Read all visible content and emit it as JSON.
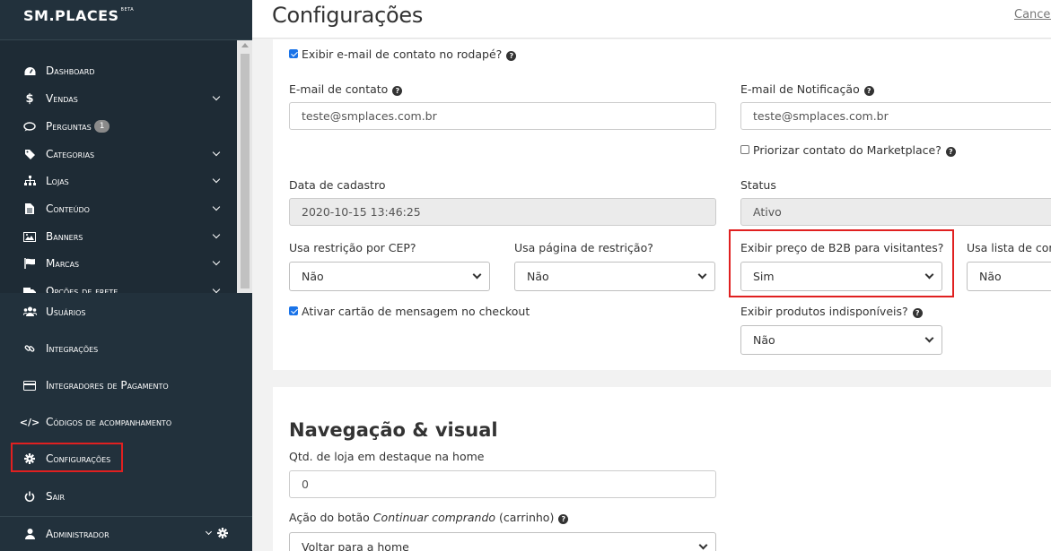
{
  "brand": {
    "logo": "SM.PLACES",
    "beta": "BETA"
  },
  "sidebar": {
    "items": [
      {
        "label": "Dashboard",
        "icon": "dashboard-icon"
      },
      {
        "label": "Vendas",
        "icon": "dollar-icon"
      },
      {
        "label": "Perguntas",
        "icon": "chat-icon",
        "badge": "1"
      },
      {
        "label": "Categorias",
        "icon": "tags-icon"
      },
      {
        "label": "Lojas",
        "icon": "sitemap-icon"
      },
      {
        "label": "Conteúdo",
        "icon": "file-icon"
      },
      {
        "label": "Banners",
        "icon": "image-icon"
      },
      {
        "label": "Marcas",
        "icon": "flag-icon"
      },
      {
        "label": "Opções de frete",
        "icon": "truck-icon"
      }
    ],
    "lower": [
      {
        "label": "Usuários",
        "icon": "users-icon"
      },
      {
        "label": "Integrações",
        "icon": "link-icon"
      },
      {
        "label": "Integradores de Pagamento",
        "icon": "credit-card-icon"
      },
      {
        "label": "Códigos de acompanhamento",
        "icon": "code-icon"
      },
      {
        "label": "Configurações",
        "icon": "gear-icon",
        "active": true
      },
      {
        "label": "Sair",
        "icon": "power-icon"
      }
    ],
    "user": {
      "label": "Administrador",
      "icon": "user-icon"
    }
  },
  "header": {
    "title": "Configurações",
    "cancel": "Cancela"
  },
  "form": {
    "show_email_footer": {
      "label": "Exibir e-mail de contato no rodapé?",
      "checked": true
    },
    "contact_email": {
      "label": "E-mail de contato",
      "value": "teste@smplaces.com.br"
    },
    "notify_email": {
      "label": "E-mail de Notificação",
      "value": "teste@smplaces.com.br"
    },
    "prioritize_marketplace": {
      "label": "Priorizar contato do Marketplace?",
      "checked": false
    },
    "signup_date": {
      "label": "Data de cadastro",
      "value": "2020-10-15 13:46:25"
    },
    "status": {
      "label": "Status",
      "value": "Ativo"
    },
    "cep_restriction": {
      "label": "Usa restrição por CEP?",
      "value": "Não"
    },
    "restriction_page": {
      "label": "Usa página de restrição?",
      "value": "Não"
    },
    "b2b_price": {
      "label": "Exibir preço de B2B para visitantes?",
      "value": "Sim"
    },
    "list_usage": {
      "label": "Usa lista de com",
      "value": "Não"
    },
    "message_card": {
      "label": "Ativar cartão de mensagem no checkout",
      "checked": true
    },
    "show_unavailable": {
      "label": "Exibir produtos indisponíveis?",
      "value": "Não"
    }
  },
  "nav_visual": {
    "title": "Navegação & visual",
    "featured_qty": {
      "label": "Qtd. de loja em destaque na home",
      "value": "0"
    },
    "continue_button": {
      "label_pre": "Ação do botão ",
      "label_em": "Continuar comprando",
      "label_post": " (carrinho)",
      "value": "Voltar para a home"
    }
  },
  "colors": {
    "sidebar": "#22313c",
    "highlight": "#e02020",
    "checkbox": "#1a73e8"
  }
}
